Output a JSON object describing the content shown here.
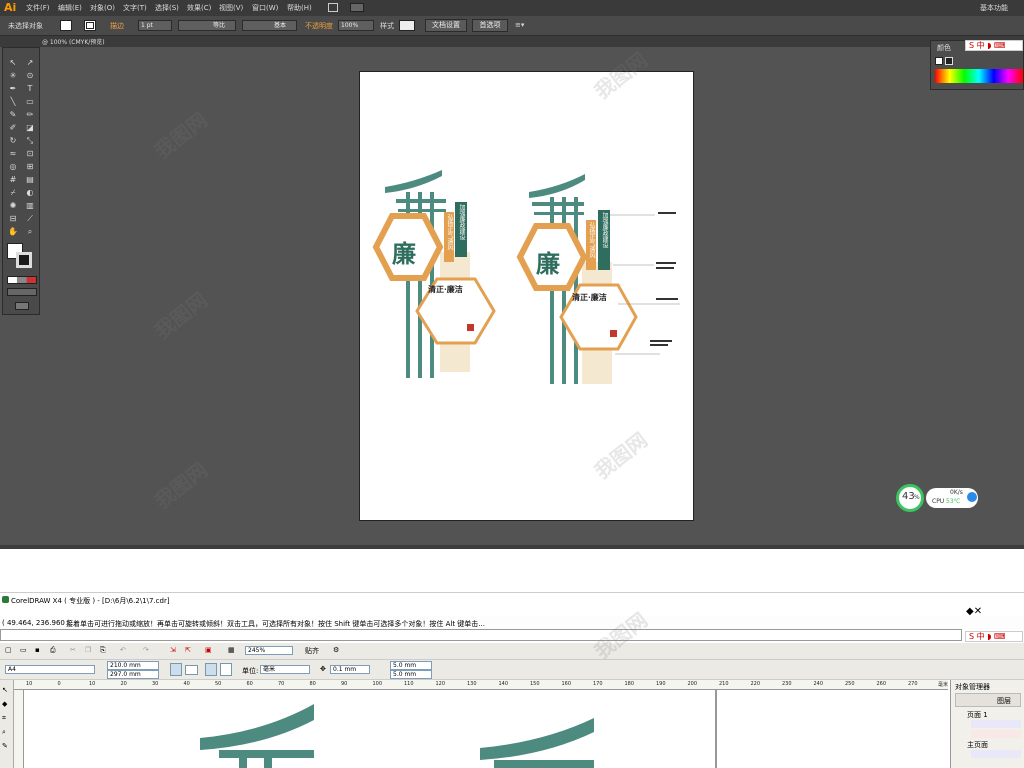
{
  "ai": {
    "logo": "Ai",
    "menu": [
      "文件(F)",
      "编辑(E)",
      "对象(O)",
      "文字(T)",
      "选择(S)",
      "效果(C)",
      "视图(V)",
      "窗口(W)",
      "帮助(H)"
    ],
    "workspace_label": "基本功能",
    "control": {
      "no_selection": "未选择对象",
      "stroke_label": "描边",
      "stroke_weight": "1 pt",
      "stroke_profile": "等比",
      "brush": "基本",
      "opacity_label": "不透明度",
      "opacity_value": "100%",
      "style_label": "样式",
      "doc_setup_button": "文档设置",
      "preferences_button": "首选项"
    },
    "doc_tab": "@ 100% (CMYK/预览)",
    "color_panel": {
      "tab": "颜色"
    },
    "artwork": {
      "left": {
        "char": "廉",
        "vertical_1": "加强廉政建设",
        "vertical_2": "弘扬正气清风",
        "hex_title": "清正·廉洁"
      },
      "right": {
        "char": "廉",
        "vertical_1": "加强廉政建设",
        "vertical_2": "弘扬正气清风",
        "hex_title": "清正·廉洁"
      }
    },
    "speed_widget": {
      "percent": "43",
      "unit": "%",
      "net": "0K/s",
      "cpu_label": "CPU",
      "cpu_temp": "53℃"
    }
  },
  "cdr": {
    "title": "CorelDRAW X4 ( 专业版 ) - [D:\\6月\\6.2\\1\\7.cdr]",
    "coords": "( 49.464, 236.960 )",
    "hint": "接着单击可进行拖动或缩放！再单击可旋转或倾斜！双击工具，可选择所有对象！按住 Shift 键单击可选择多个对象！按住 Alt 键单击...",
    "zoom": "245%",
    "snap_label": "贴齐",
    "page_size": "A4",
    "width": "210.0 mm",
    "height": "297.0 mm",
    "units_label": "单位:",
    "units_value": "毫米",
    "nudge": "0.1 mm",
    "dup_x": "5.0 mm",
    "dup_y": "5.0 mm",
    "ruler_ticks": [
      "10",
      "0",
      "10",
      "20",
      "30",
      "40",
      "50",
      "60",
      "70",
      "80",
      "90",
      "100",
      "110",
      "120",
      "130",
      "140",
      "150",
      "160",
      "170",
      "180",
      "190",
      "200",
      "210",
      "220",
      "230",
      "240",
      "250",
      "260",
      "270"
    ],
    "ruler_unit": "毫米",
    "object_manager": {
      "title": "对象管理器",
      "page": "页面 1",
      "master": "主页面",
      "layer_label": "图层"
    }
  },
  "watermark": "我图网",
  "colors": {
    "teal": "#4d8a80",
    "dark_teal": "#2f6e5e",
    "orange": "#e3a050",
    "beige": "#f4e8d0"
  }
}
